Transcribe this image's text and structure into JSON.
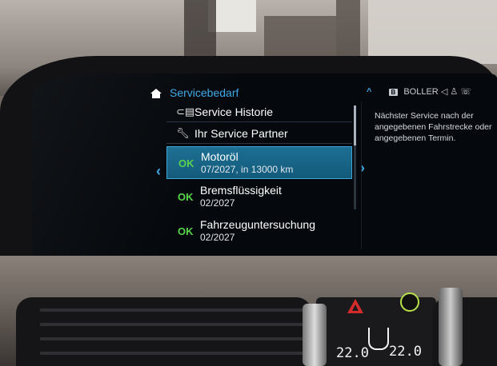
{
  "header": {
    "title": "Servicebedarf",
    "status_chevron": "^",
    "status_badge": "B",
    "status_name": "BOLLER",
    "status_icons": "◁  ♙  ☏"
  },
  "menu": {
    "history_label": "Service Historie",
    "partner_label": "Ihr Service Partner"
  },
  "items": [
    {
      "status": "OK",
      "title": "Motoröl",
      "detail": "07/2027, in 13000 km",
      "selected": true
    },
    {
      "status": "OK",
      "title": "Bremsflüssigkeit",
      "detail": "02/2027",
      "selected": false
    },
    {
      "status": "OK",
      "title": "Fahrzeuguntersuchung",
      "detail": "02/2027",
      "selected": false
    }
  ],
  "info": {
    "text": "Nächster Service nach der angegebenen Fahrstrecke oder angegebenen Termin."
  },
  "climate": {
    "left_temp": "22.0",
    "right_temp": "22.0"
  },
  "colors": {
    "accent": "#3fa9e8",
    "ok": "#58d34a",
    "selected_bg": "#1c6f93",
    "screen_bg": "#05080c",
    "hazard": "#d42a2a"
  },
  "icons": {
    "home": "home-icon",
    "history": "wrench-car-icon",
    "partner": "wrench-icon",
    "nav_left": "chevron-left-icon",
    "nav_right": "chevron-right-icon"
  }
}
